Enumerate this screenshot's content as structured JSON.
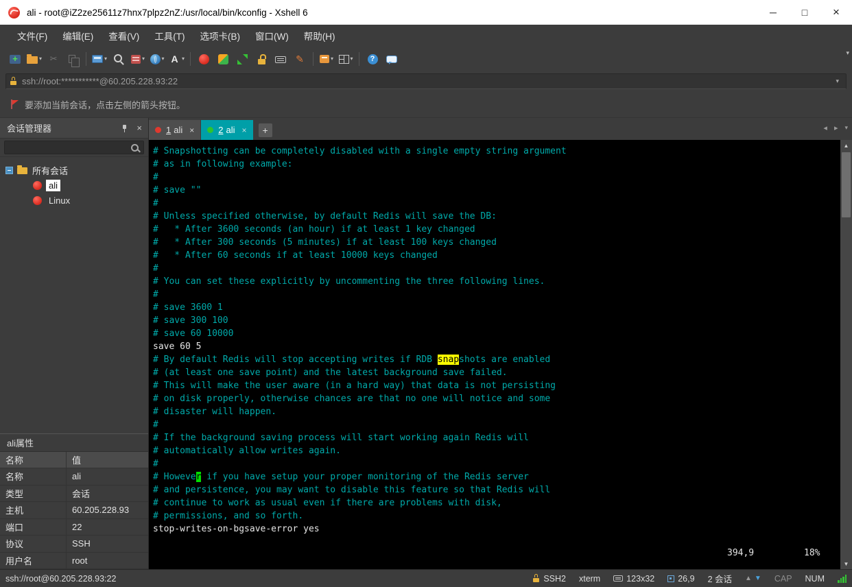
{
  "window": {
    "title": "ali - root@iZ2ze25611z7hnx7plpz2nZ:/usr/local/bin/kconfig - Xshell 6"
  },
  "icons": {
    "minimize": "─",
    "maximize": "□",
    "close": "×",
    "caret_down": "▾",
    "plus": "+",
    "nav_left": "◂",
    "nav_right": "▸",
    "up_arrow": "▲",
    "down_arrow": "▼",
    "tab_close": "×",
    "panel_close": "×",
    "scroll_up": "▲",
    "scroll_down": "▼"
  },
  "menu_bar": {
    "items": [
      "文件(F)",
      "编辑(E)",
      "查看(V)",
      "工具(T)",
      "选项卡(B)",
      "窗口(W)",
      "帮助(H)"
    ]
  },
  "toolbar": {
    "icons": [
      {
        "name": "new-session-icon",
        "style": "new"
      },
      {
        "name": "open-session-folder-icon",
        "style": "folder",
        "dropdown": true
      },
      {
        "name": "cut-icon",
        "style": "cut",
        "disabled": true
      },
      {
        "name": "copy-icon",
        "style": "copy",
        "disabled": true
      },
      {
        "name": "separator"
      },
      {
        "name": "session-dialog-icon",
        "style": "dialog",
        "dropdown": true
      },
      {
        "name": "find-icon",
        "style": "find"
      },
      {
        "name": "server-icon",
        "style": "server",
        "dropdown": true
      },
      {
        "name": "proxy-globe-icon",
        "style": "globe",
        "dropdown": true
      },
      {
        "name": "font-icon",
        "style": "fonts",
        "dropdown": true
      },
      {
        "name": "separator"
      },
      {
        "name": "xshell-icon",
        "style": "xshell"
      },
      {
        "name": "xftp-icon",
        "style": "xftp"
      },
      {
        "name": "fullscreen-icon",
        "style": "fullscreen"
      },
      {
        "name": "lock-screen-icon",
        "style": "lock"
      },
      {
        "name": "virtual-keyboard-icon",
        "style": "keyboard"
      },
      {
        "name": "highlight-pen-icon",
        "style": "pen"
      },
      {
        "name": "separator"
      },
      {
        "name": "transfer-box-icon",
        "style": "box",
        "dropdown": true
      },
      {
        "name": "window-layout-icon",
        "style": "tiles",
        "dropdown": true
      },
      {
        "name": "separator"
      },
      {
        "name": "help-icon",
        "style": "help"
      },
      {
        "name": "feedback-chat-icon",
        "style": "chat"
      }
    ]
  },
  "address_bar": {
    "value": "ssh://root:***********@60.205.228.93:22"
  },
  "info_bar": {
    "text": "要添加当前会话，点击左侧的箭头按钮。"
  },
  "session_manager": {
    "title": "会话管理器",
    "root_folder": "所有会话",
    "sessions": [
      {
        "label": "ali",
        "selected": true
      },
      {
        "label": "Linux",
        "selected": false
      }
    ]
  },
  "tab_bar": {
    "tabs": [
      {
        "num": "1",
        "label": "ali",
        "active": false,
        "status_color": "#e0392e"
      },
      {
        "num": "2",
        "label": "ali",
        "active": true,
        "status_color": "#2ec42e"
      }
    ]
  },
  "terminal": {
    "ruler_position": "394,9",
    "ruler_percent": "18%",
    "lines": [
      {
        "segs": [
          {
            "t": "# Snapshotting can be completely disabled with a single empty string argument",
            "c": "comment"
          }
        ]
      },
      {
        "segs": [
          {
            "t": "# as in following example:",
            "c": "comment"
          }
        ]
      },
      {
        "segs": [
          {
            "t": "#",
            "c": "comment"
          }
        ]
      },
      {
        "segs": [
          {
            "t": "# save \"\"",
            "c": "comment"
          }
        ]
      },
      {
        "segs": [
          {
            "t": "#",
            "c": "comment"
          }
        ]
      },
      {
        "segs": [
          {
            "t": "# Unless specified otherwise, by default Redis will save the DB:",
            "c": "comment"
          }
        ]
      },
      {
        "segs": [
          {
            "t": "#   * After 3600 seconds (an hour) if at least 1 key changed",
            "c": "comment"
          }
        ]
      },
      {
        "segs": [
          {
            "t": "#   * After 300 seconds (5 minutes) if at least 100 keys changed",
            "c": "comment"
          }
        ]
      },
      {
        "segs": [
          {
            "t": "#   * After 60 seconds if at least 10000 keys changed",
            "c": "comment"
          }
        ]
      },
      {
        "segs": [
          {
            "t": "#",
            "c": "comment"
          }
        ]
      },
      {
        "segs": [
          {
            "t": "# You can set these explicitly by uncommenting the three following lines.",
            "c": "comment"
          }
        ]
      },
      {
        "segs": [
          {
            "t": "#",
            "c": "comment"
          }
        ]
      },
      {
        "segs": [
          {
            "t": "# save 3600 1",
            "c": "comment"
          }
        ]
      },
      {
        "segs": [
          {
            "t": "# save 300 100",
            "c": "comment"
          }
        ]
      },
      {
        "segs": [
          {
            "t": "# save 60 10000",
            "c": "comment"
          }
        ]
      },
      {
        "segs": [
          {
            "t": "save 60 5",
            "c": "plain"
          }
        ]
      },
      {
        "segs": [
          {
            "t": "# By default Redis will stop accepting writes if RDB ",
            "c": "comment"
          },
          {
            "t": "snap",
            "c": "search"
          },
          {
            "t": "shots are enabled",
            "c": "comment"
          }
        ]
      },
      {
        "segs": [
          {
            "t": "# (at least one save point) and the latest background save failed.",
            "c": "comment"
          }
        ]
      },
      {
        "segs": [
          {
            "t": "# This will make the user aware (in a hard way) that data is not persisting",
            "c": "comment"
          }
        ]
      },
      {
        "segs": [
          {
            "t": "# on disk properly, otherwise chances are that no one will notice and some",
            "c": "comment"
          }
        ]
      },
      {
        "segs": [
          {
            "t": "# disaster will happen.",
            "c": "comment"
          }
        ]
      },
      {
        "segs": [
          {
            "t": "#",
            "c": "comment"
          }
        ]
      },
      {
        "segs": [
          {
            "t": "# If the background saving process will start working again Redis will",
            "c": "comment"
          }
        ]
      },
      {
        "segs": [
          {
            "t": "# automatically allow writes again.",
            "c": "comment"
          }
        ]
      },
      {
        "segs": [
          {
            "t": "#",
            "c": "comment"
          }
        ]
      },
      {
        "segs": [
          {
            "t": "# Howeve",
            "c": "comment"
          },
          {
            "t": "r",
            "c": "cursor"
          },
          {
            "t": " if you have setup your proper monitoring of the Redis server",
            "c": "comment"
          }
        ]
      },
      {
        "segs": [
          {
            "t": "# and persistence, you may want to disable this feature so that Redis will",
            "c": "comment"
          }
        ]
      },
      {
        "segs": [
          {
            "t": "# continue to work as usual even if there are problems with disk,",
            "c": "comment"
          }
        ]
      },
      {
        "segs": [
          {
            "t": "# permissions, and so forth.",
            "c": "comment"
          }
        ]
      },
      {
        "segs": [
          {
            "t": "stop-writes-on-bgsave-error yes",
            "c": "plain"
          }
        ]
      }
    ]
  },
  "properties": {
    "title": "ali属性",
    "headers": [
      "名称",
      "值"
    ],
    "rows": [
      [
        "名称",
        "ali"
      ],
      [
        "类型",
        "会话"
      ],
      [
        "主机",
        "60.205.228.93"
      ],
      [
        "端口",
        "22"
      ],
      [
        "协议",
        "SSH"
      ],
      [
        "用户名",
        "root"
      ]
    ]
  },
  "status_bar": {
    "connection": "ssh://root@60.205.228.93:22",
    "protocol": "SSH2",
    "terminal_type": "xterm",
    "screen_size": "123x32",
    "cursor_position": "26,9",
    "session_count": "2 会话",
    "caps_lock": "CAP",
    "num_lock": "NUM"
  },
  "colors": {
    "terminal_comment": "#00AAAA",
    "terminal_plain": "#E6E6E6",
    "search_highlight_bg": "#FFFF00",
    "cursor_bg": "#00DD00",
    "active_tab_bg": "#009FA8",
    "brand_red": "#D92B1F"
  }
}
